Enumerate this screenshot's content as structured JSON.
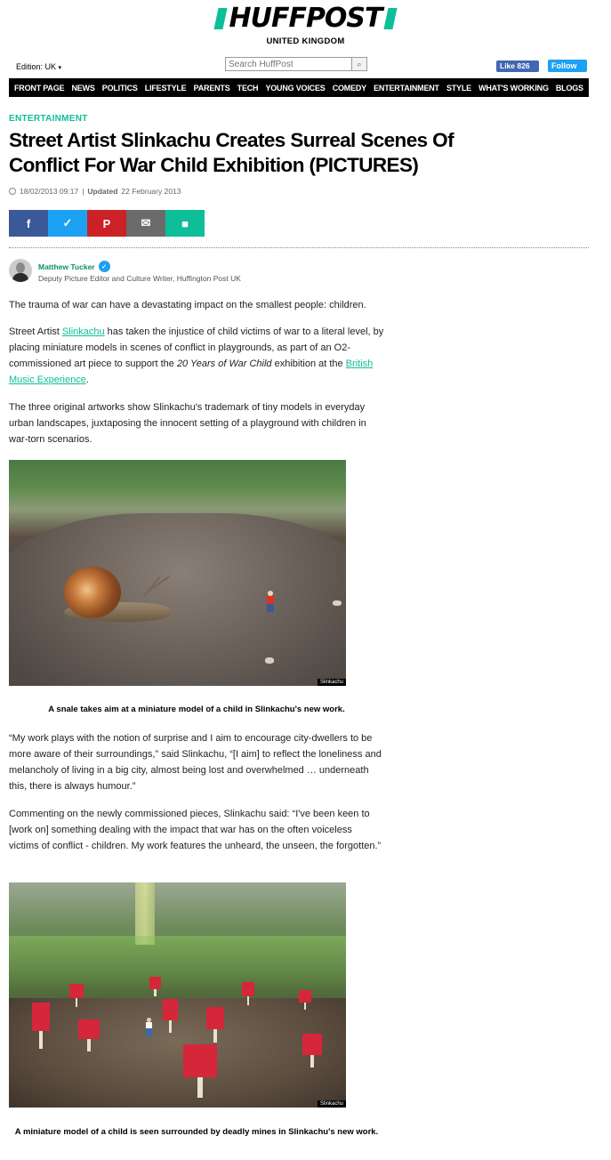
{
  "brand": {
    "name": "HUFFPOST",
    "edition_label": "UNITED KINGDOM",
    "accent": "#0dbe98"
  },
  "topbar": {
    "edition": "Edition: UK",
    "search_placeholder": "Search HuffPost",
    "search_icon": "search-icon",
    "like_label": "Like 826",
    "follow_label": "Follow"
  },
  "nav": {
    "items": [
      "FRONT PAGE",
      "NEWS",
      "POLITICS",
      "LIFESTYLE",
      "PARENTS",
      "TECH",
      "YOUNG VOICES",
      "COMEDY",
      "ENTERTAINMENT",
      "STYLE",
      "WHAT'S WORKING",
      "BLOGS"
    ]
  },
  "article": {
    "category": "ENTERTAINMENT",
    "headline": "Street Artist Slinkachu Creates Surreal Scenes Of Conflict For War Child Exhibition (PICTURES)",
    "published": "18/02/2013 09:17",
    "updated_label": "Updated",
    "updated": "22 February 2013",
    "share": {
      "facebook_icon": "f",
      "twitter_icon": "🐦",
      "pinterest_icon": "P",
      "email_icon": "✉",
      "comment_icon": "■"
    },
    "author": {
      "name": "Matthew Tucker",
      "role": "Deputy Picture Editor and Culture Writer, Huffington Post UK"
    },
    "paragraphs": {
      "p1": "The trauma of war can have a devastating impact on the smallest people: children.",
      "p2_a": "Street Artist ",
      "p2_link": "Slinkachu",
      "p2_b": " has taken the injustice of child victims of war to a literal level, by placing miniature models in scenes of conflict in playgrounds, as part of an O2-commissioned art piece to support the ",
      "p2_em": "20 Years of War Child",
      "p2_c": " exhibition at the ",
      "p2_link2": "British Music Experience",
      "p2_d": ".",
      "p3": "The three original artworks show Slinkachu's trademark of tiny models in everyday urban landscapes, juxtaposing the innocent setting of a playground with children in war-torn scenarios.",
      "p4": "“My work plays with the notion of surprise and I aim to encourage city-dwellers to be more aware of their surroundings,” said Slinkachu, “[I aim] to reflect the loneliness and melancholy of living in a big city, almost being lost and overwhelmed … underneath this, there is always humour.”",
      "p5": "Commenting on the newly commissioned pieces, Slinkachu said: “I've been keen to [work on] something dealing with the impact that war has on the often voiceless victims of conflict - children. My work features the unheard, the unseen, the forgotten.”"
    },
    "photos": [
      {
        "credit": "Slinkachu",
        "caption": "A snale takes aim at a miniature model of a child in Slinkachu's new work."
      },
      {
        "credit": "Slinkachu",
        "caption": "A miniature model of a child is seen surrounded by deadly mines in Slinkachu's new work."
      }
    ]
  }
}
